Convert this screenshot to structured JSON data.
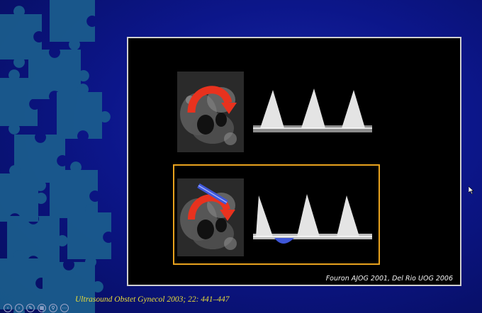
{
  "slide": {
    "image_credit": "Fouron AJOG 2001, Del Rio UOG 2006",
    "citation": "Ultrasound Obstet Gynecol 2003; 22: 441–447"
  },
  "toolbar": {
    "buttons": [
      {
        "icon": "previous-icon",
        "glyph": "‹"
      },
      {
        "icon": "next-icon",
        "glyph": "›"
      },
      {
        "icon": "pen-icon",
        "glyph": "✎"
      },
      {
        "icon": "slides-icon",
        "glyph": "▦"
      },
      {
        "icon": "zoom-icon",
        "glyph": "⚲"
      },
      {
        "icon": "more-icon",
        "glyph": "⋯"
      }
    ]
  },
  "colors": {
    "background": "#0c168a",
    "puzzle": "#1b5f8e",
    "arrow_red": "#e8321e",
    "arrow_blue": "#3f57d8",
    "highlight": "#e8a21e",
    "citation": "#e8dc3a"
  }
}
